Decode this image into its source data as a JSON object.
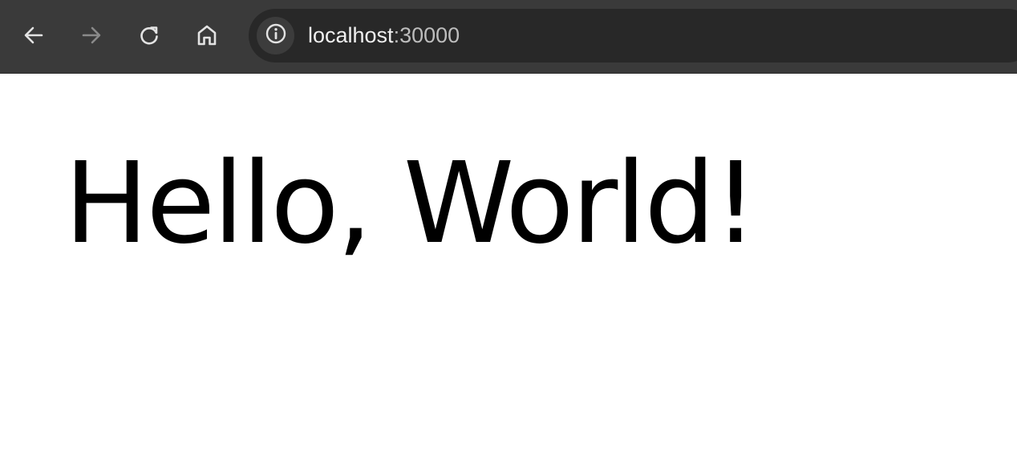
{
  "browser": {
    "nav": {
      "back_icon": "arrow-left-icon",
      "forward_icon": "arrow-right-icon",
      "reload_icon": "reload-icon",
      "home_icon": "home-icon"
    },
    "address_bar": {
      "site_info_icon": "info-icon",
      "host": "localhost",
      "port": ":30000"
    }
  },
  "page": {
    "heading": "Hello, World!"
  },
  "colors": {
    "toolbar_bg": "#3a3a3a",
    "omnibox_bg": "#282828",
    "icon_active": "#e3e3e3",
    "icon_disabled": "#8a8a8a",
    "page_bg": "#ffffff",
    "text": "#000000"
  }
}
